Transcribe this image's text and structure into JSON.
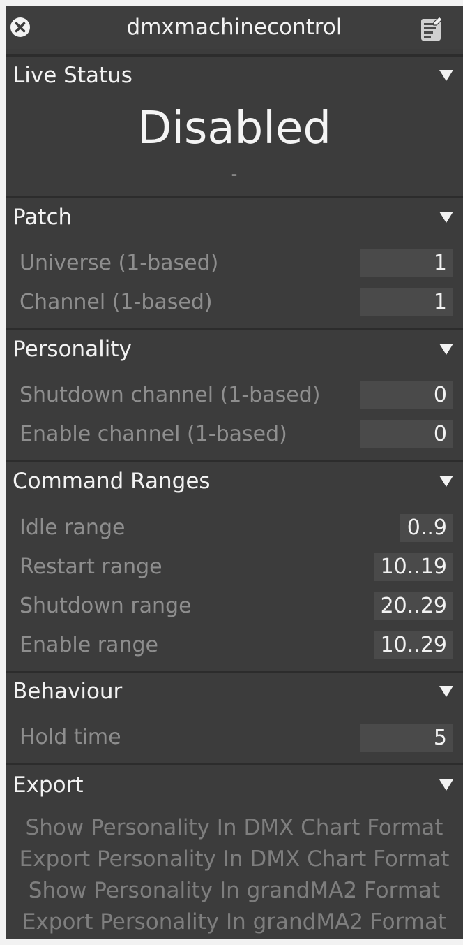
{
  "window": {
    "title": "dmxmachinecontrol",
    "icons": {
      "close": "close-circle-icon",
      "notes": "notes-icon"
    }
  },
  "live_status": {
    "header": "Live Status",
    "status": "Disabled",
    "detail": "-"
  },
  "patch": {
    "header": "Patch",
    "rows": [
      {
        "label": "Universe (1-based)",
        "value": "1"
      },
      {
        "label": "Channel (1-based)",
        "value": "1"
      }
    ]
  },
  "personality": {
    "header": "Personality",
    "rows": [
      {
        "label": "Shutdown channel (1-based)",
        "value": "0"
      },
      {
        "label": "Enable channel (1-based)",
        "value": "0"
      }
    ]
  },
  "command_ranges": {
    "header": "Command Ranges",
    "rows": [
      {
        "label": "Idle range",
        "value": "0..9"
      },
      {
        "label": "Restart range",
        "value": "10..19"
      },
      {
        "label": "Shutdown range",
        "value": "20..29"
      },
      {
        "label": "Enable range",
        "value": "10..29"
      }
    ]
  },
  "behaviour": {
    "header": "Behaviour",
    "rows": [
      {
        "label": "Hold time",
        "value": "5"
      }
    ]
  },
  "export": {
    "header": "Export",
    "links": [
      "Show Personality In DMX Chart Format",
      "Export Personality In DMX Chart Format",
      "Show Personality In grandMA2 Format",
      "Export Personality In grandMA2 Format"
    ]
  },
  "colors": {
    "panel_bg": "#3c3c3c",
    "field_bg": "#4a4a4a",
    "text": "#f2f2f2",
    "muted_text": "#8e8e8e"
  }
}
